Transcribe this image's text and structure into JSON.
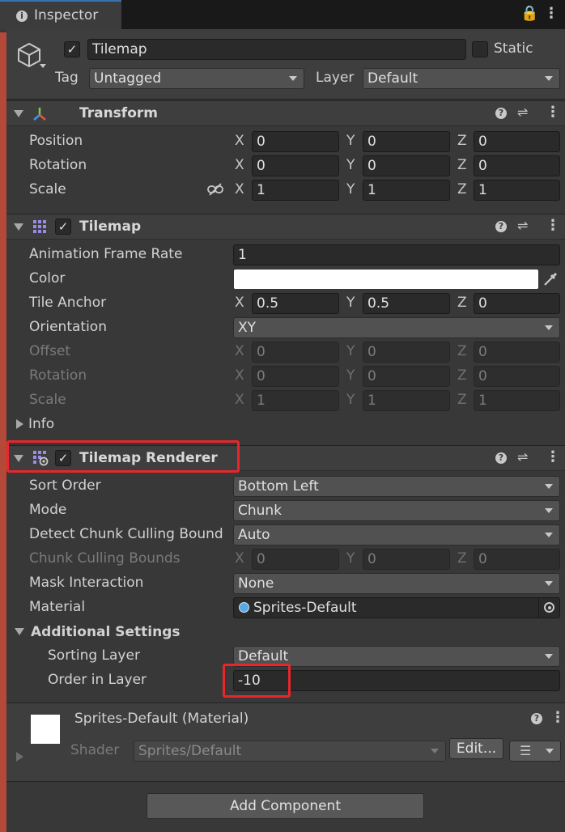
{
  "tab": {
    "title": "Inspector"
  },
  "gameobject": {
    "name": "Tilemap",
    "static_label": "Static",
    "tag_label": "Tag",
    "tag_value": "Untagged",
    "layer_label": "Layer",
    "layer_value": "Default"
  },
  "transform": {
    "title": "Transform",
    "position": {
      "label": "Position",
      "x": "0",
      "y": "0",
      "z": "0"
    },
    "rotation": {
      "label": "Rotation",
      "x": "0",
      "y": "0",
      "z": "0"
    },
    "scale": {
      "label": "Scale",
      "x": "1",
      "y": "1",
      "z": "1"
    }
  },
  "tilemap": {
    "title": "Tilemap",
    "animation_frame_rate": {
      "label": "Animation Frame Rate",
      "value": "1"
    },
    "color": {
      "label": "Color",
      "value": "#ffffff"
    },
    "tile_anchor": {
      "label": "Tile Anchor",
      "x": "0.5",
      "y": "0.5",
      "z": "0"
    },
    "orientation": {
      "label": "Orientation",
      "value": "XY"
    },
    "offset": {
      "label": "Offset",
      "x": "0",
      "y": "0",
      "z": "0"
    },
    "rotation": {
      "label": "Rotation",
      "x": "0",
      "y": "0",
      "z": "0"
    },
    "scale": {
      "label": "Scale",
      "x": "1",
      "y": "1",
      "z": "1"
    },
    "info_label": "Info"
  },
  "renderer": {
    "title": "Tilemap Renderer",
    "sort_order": {
      "label": "Sort Order",
      "value": "Bottom Left"
    },
    "mode": {
      "label": "Mode",
      "value": "Chunk"
    },
    "detect_chunk": {
      "label": "Detect Chunk Culling Bound",
      "value": "Auto"
    },
    "chunk_bounds": {
      "label": "Chunk Culling Bounds",
      "x": "0",
      "y": "0",
      "z": "0"
    },
    "mask_interaction": {
      "label": "Mask Interaction",
      "value": "None"
    },
    "material": {
      "label": "Material",
      "value": "Sprites-Default"
    },
    "additional_settings": "Additional Settings",
    "sorting_layer": {
      "label": "Sorting Layer",
      "value": "Default"
    },
    "order_in_layer": {
      "label": "Order in Layer",
      "value": "-10"
    }
  },
  "material_section": {
    "title": "Sprites-Default (Material)",
    "shader_label": "Shader",
    "shader_value": "Sprites/Default",
    "edit_button": "Edit..."
  },
  "axes": {
    "x": "X",
    "y": "Y",
    "z": "Z"
  },
  "add_component": "Add Component",
  "colors": {
    "highlight": "#e8262b",
    "accent": "#3a72b0"
  }
}
